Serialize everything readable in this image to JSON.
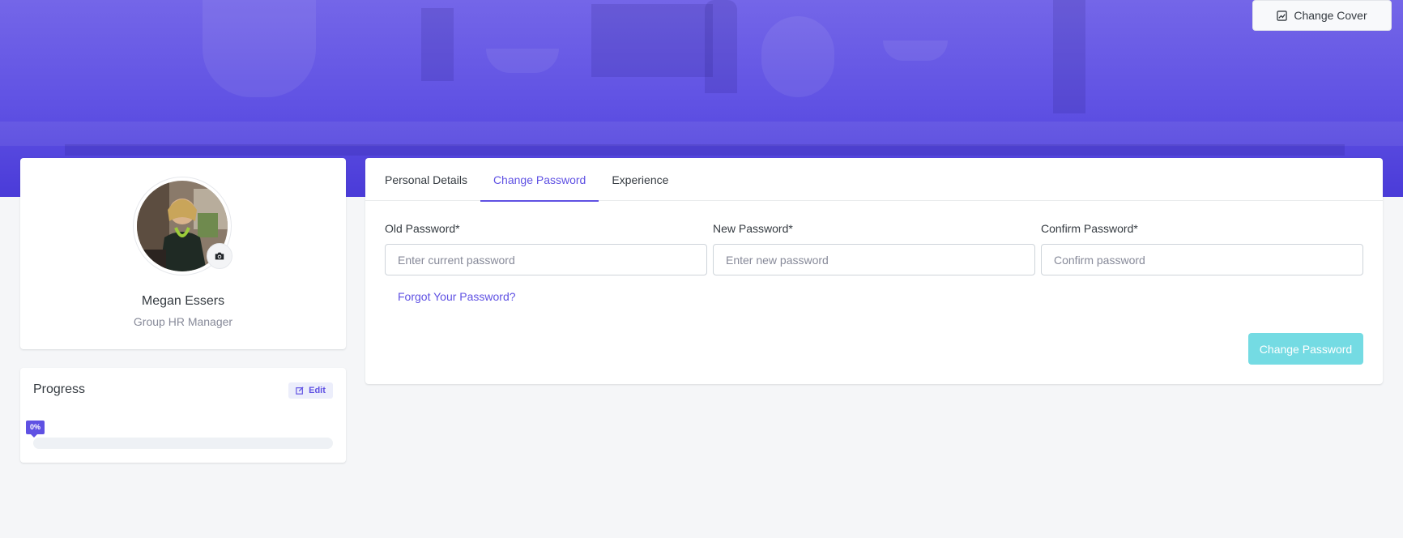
{
  "cover": {
    "change_cover_label": "Change Cover",
    "accent": "#5f51e3"
  },
  "profile": {
    "name": "Megan Essers",
    "role": "Group HR Manager"
  },
  "progress": {
    "title": "Progress",
    "edit_label": "Edit",
    "badge_text": "0%",
    "value_percent": 0
  },
  "tabs": [
    {
      "label": "Personal Details",
      "active": false
    },
    {
      "label": "Change Password",
      "active": true
    },
    {
      "label": "Experience",
      "active": false
    }
  ],
  "form": {
    "old_password": {
      "label": "Old Password*",
      "placeholder": "Enter current password",
      "value": ""
    },
    "new_password": {
      "label": "New Password*",
      "placeholder": "Enter new password",
      "value": ""
    },
    "confirm_password": {
      "label": "Confirm Password*",
      "placeholder": "Confirm password",
      "value": ""
    },
    "forgot_label": "Forgot Your Password?",
    "submit_label": "Change Password"
  }
}
